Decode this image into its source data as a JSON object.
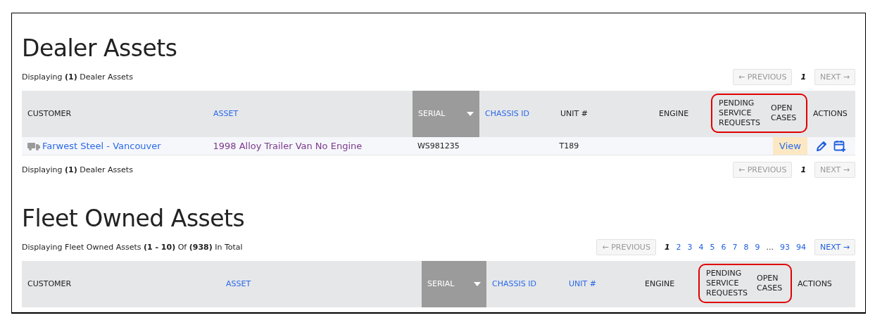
{
  "sections": [
    {
      "title": "Dealer Assets",
      "summary_top": "Displaying **(1)** Dealer Assets",
      "pagination_top": {
        "previous": {
          "label": "← PREVIOUS",
          "disabled": true
        },
        "pages": [
          {
            "label": "1",
            "selected": true
          }
        ],
        "next": {
          "label": "NEXT →",
          "disabled": true
        }
      },
      "columns": [
        {
          "label": "CUSTOMER",
          "sortable": false,
          "sorted": false,
          "highlighted": false
        },
        {
          "label": "ASSET",
          "sortable": true,
          "sorted": false,
          "highlighted": false
        },
        {
          "label": "SERIAL",
          "sortable": false,
          "sorted": true,
          "highlighted": false
        },
        {
          "label": "CHASSIS ID",
          "sortable": true,
          "sorted": false,
          "highlighted": false
        },
        {
          "label": "UNIT #",
          "sortable": false,
          "sorted": false,
          "highlighted": false
        },
        {
          "label": "ENGINE",
          "sortable": false,
          "sorted": false,
          "highlighted": false
        },
        {
          "label": "PENDING SERVICE REQUESTS",
          "sortable": false,
          "sorted": false,
          "highlighted": true
        },
        {
          "label": "OPEN CASES",
          "sortable": false,
          "sorted": false,
          "highlighted": true
        },
        {
          "label": "ACTIONS",
          "sortable": false,
          "sorted": false,
          "highlighted": false
        }
      ],
      "rows": [
        {
          "customer": "Farwest Steel - Vancouver",
          "asset": "1998 Alloy Trailer Van No Engine",
          "serial": "WS981235",
          "unit": "T189",
          "open_cases": "View"
        }
      ],
      "summary_bottom": "Displaying **(1)** Dealer Assets",
      "pagination_bottom": {
        "previous": {
          "label": "← PREVIOUS",
          "disabled": true
        },
        "pages": [
          {
            "label": "1",
            "selected": true
          }
        ],
        "next": {
          "label": "NEXT →",
          "disabled": true
        }
      }
    },
    {
      "title": "Fleet Owned Assets",
      "summary_top": "Displaying Fleet Owned Assets **(1 - 10)** Of **(938)** In Total",
      "pagination_top": {
        "previous": {
          "label": "← PREVIOUS",
          "disabled": true
        },
        "pages": [
          {
            "label": "1",
            "selected": true
          },
          {
            "label": "2",
            "selected": false
          },
          {
            "label": "3",
            "selected": false
          },
          {
            "label": "4",
            "selected": false
          },
          {
            "label": "5",
            "selected": false
          },
          {
            "label": "6",
            "selected": false
          },
          {
            "label": "7",
            "selected": false
          },
          {
            "label": "8",
            "selected": false
          },
          {
            "label": "9",
            "selected": false
          },
          {
            "label": "...",
            "kind": "ellipsis"
          },
          {
            "label": "93",
            "selected": false
          },
          {
            "label": "94",
            "selected": false
          }
        ],
        "next": {
          "label": "NEXT →",
          "disabled": false
        }
      },
      "columns": [
        {
          "label": "CUSTOMER",
          "sortable": false,
          "sorted": false,
          "highlighted": false
        },
        {
          "label": "ASSET",
          "sortable": true,
          "sorted": false,
          "highlighted": false
        },
        {
          "label": "SERIAL",
          "sortable": false,
          "sorted": true,
          "highlighted": false
        },
        {
          "label": "CHASSIS ID",
          "sortable": true,
          "sorted": false,
          "highlighted": false
        },
        {
          "label": "UNIT #",
          "sortable": true,
          "sorted": false,
          "highlighted": false
        },
        {
          "label": "ENGINE",
          "sortable": false,
          "sorted": false,
          "highlighted": false
        },
        {
          "label": "PENDING SERVICE REQUESTS",
          "sortable": false,
          "sorted": false,
          "highlighted": true
        },
        {
          "label": "OPEN CASES",
          "sortable": false,
          "sorted": false,
          "highlighted": true
        },
        {
          "label": "ACTIONS",
          "sortable": false,
          "sorted": false,
          "highlighted": false
        }
      ]
    }
  ]
}
